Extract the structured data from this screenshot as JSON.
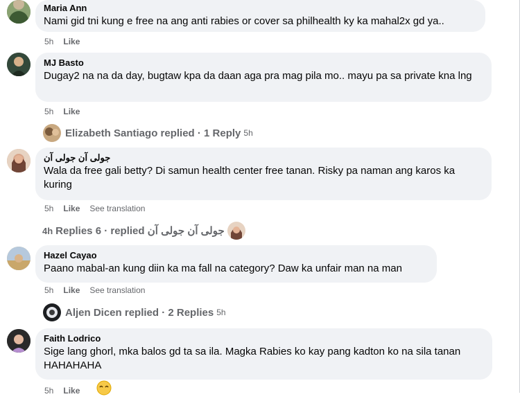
{
  "labels": {
    "like": "Like",
    "see_translation": "See translation"
  },
  "comments": [
    {
      "author": "Maria Ann",
      "text": "Nami gid tni kung e free na ang anti rabies or cover sa philhealth ky ka mahal2x gd ya..",
      "time": "5h"
    },
    {
      "author": "MJ Basto",
      "text": "Dugay2 na na da day, bugtaw kpa da daan aga pra mag pila mo.. mayu pa sa private kna lng",
      "time": "5h"
    },
    {
      "author": "جولی آن جولی آن",
      "text": "Wala da free gali betty? Di samun health center free tanan. Risky pa naman ang karos ka kuring",
      "time": "5h"
    },
    {
      "author": "Hazel Cayao",
      "text": "Paano mabal-an kung diin ka ma fall na category? Daw ka unfair man na man",
      "time": "5h"
    },
    {
      "author": "Faith Lodrico",
      "text": "Sige lang ghorl, mka balos gd ta sa ila. Magka Rabies ko kay pang kadton ko na sila tanan HAHAHAHA",
      "time": "5h"
    }
  ],
  "replies": [
    {
      "summary": "Elizabeth Santiago replied · 1 Reply",
      "time": "5h"
    },
    {
      "summary": "Replies 6 · replied جولی آن جولی آن",
      "time": "4h"
    },
    {
      "summary": "Aljen Dicen replied · 2 Replies",
      "time": "5h"
    }
  ],
  "icons": {
    "reaction": "laughing-face"
  }
}
